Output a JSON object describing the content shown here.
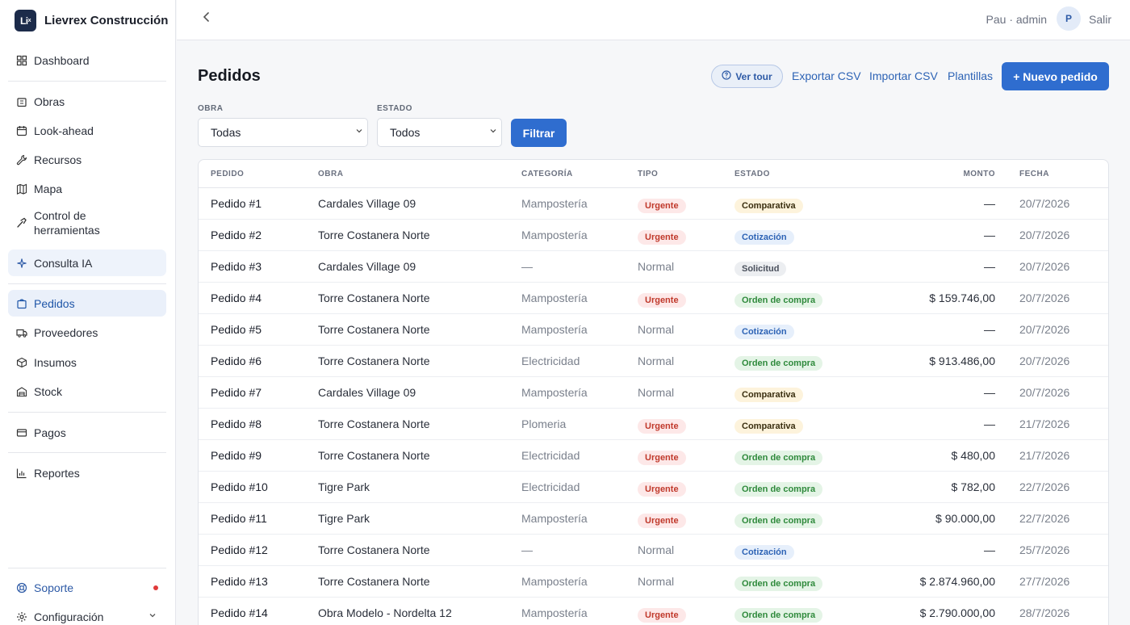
{
  "app": {
    "name": "Lievrex Construcción",
    "logo_text": "Li",
    "logo_sub": "x"
  },
  "sidebar": {
    "items": [
      {
        "label": "Dashboard",
        "icon": "grid-icon"
      },
      {
        "label": "Obras",
        "icon": "building-icon"
      },
      {
        "label": "Look-ahead",
        "icon": "calendar-icon"
      },
      {
        "label": "Recursos",
        "icon": "wrench-icon"
      },
      {
        "label": "Mapa",
        "icon": "map-icon"
      },
      {
        "label": "Control de herramientas",
        "icon": "hammer-icon"
      },
      {
        "label": "Consulta IA",
        "icon": "sparkle-icon"
      },
      {
        "label": "Pedidos",
        "icon": "cart-icon"
      },
      {
        "label": "Proveedores",
        "icon": "truck-icon"
      },
      {
        "label": "Insumos",
        "icon": "box-icon"
      },
      {
        "label": "Stock",
        "icon": "warehouse-icon"
      },
      {
        "label": "Pagos",
        "icon": "card-icon"
      },
      {
        "label": "Reportes",
        "icon": "bar-chart-icon"
      }
    ],
    "support_label": "Soporte",
    "settings_label": "Configuración",
    "active": "Pedidos"
  },
  "topbar": {
    "user": "Pau · admin",
    "avatar": "P",
    "logout": "Salir"
  },
  "page": {
    "title": "Pedidos",
    "tour_label": "Ver tour",
    "export_label": "Exportar CSV",
    "import_label": "Importar CSV",
    "templates_label": "Plantillas",
    "new_label": "+ Nuevo pedido"
  },
  "filters": {
    "obra_label": "OBRA",
    "obra_value": "Todas",
    "estado_label": "ESTADO",
    "estado_value": "Todos",
    "filter_label": "Filtrar"
  },
  "table": {
    "headers": {
      "pedido": "PEDIDO",
      "obra": "OBRA",
      "categoria": "CATEGORÍA",
      "tipo": "TIPO",
      "estado": "ESTADO",
      "monto": "MONTO",
      "fecha": "FECHA"
    },
    "rows": [
      {
        "pedido": "Pedido #1",
        "obra": "Cardales Village 09",
        "categoria": "Mampostería",
        "tipo": "Urgente",
        "estado": "Comparativa",
        "monto": "—",
        "fecha": "20/7/2026"
      },
      {
        "pedido": "Pedido #2",
        "obra": "Torre Costanera Norte",
        "categoria": "Mampostería",
        "tipo": "Urgente",
        "estado": "Cotización",
        "monto": "—",
        "fecha": "20/7/2026"
      },
      {
        "pedido": "Pedido #3",
        "obra": "Cardales Village 09",
        "categoria": "—",
        "tipo": "Normal",
        "estado": "Solicitud",
        "monto": "—",
        "fecha": "20/7/2026"
      },
      {
        "pedido": "Pedido #4",
        "obra": "Torre Costanera Norte",
        "categoria": "Mampostería",
        "tipo": "Urgente",
        "estado": "Orden de compra",
        "monto": "$ 159.746,00",
        "fecha": "20/7/2026"
      },
      {
        "pedido": "Pedido #5",
        "obra": "Torre Costanera Norte",
        "categoria": "Mampostería",
        "tipo": "Normal",
        "estado": "Cotización",
        "monto": "—",
        "fecha": "20/7/2026"
      },
      {
        "pedido": "Pedido #6",
        "obra": "Torre Costanera Norte",
        "categoria": "Electricidad",
        "tipo": "Normal",
        "estado": "Orden de compra",
        "monto": "$ 913.486,00",
        "fecha": "20/7/2026"
      },
      {
        "pedido": "Pedido #7",
        "obra": "Cardales Village 09",
        "categoria": "Mampostería",
        "tipo": "Normal",
        "estado": "Comparativa",
        "monto": "—",
        "fecha": "20/7/2026"
      },
      {
        "pedido": "Pedido #8",
        "obra": "Torre Costanera Norte",
        "categoria": "Plomeria",
        "tipo": "Urgente",
        "estado": "Comparativa",
        "monto": "—",
        "fecha": "21/7/2026"
      },
      {
        "pedido": "Pedido #9",
        "obra": "Torre Costanera Norte",
        "categoria": "Electricidad",
        "tipo": "Urgente",
        "estado": "Orden de compra",
        "monto": "$ 480,00",
        "fecha": "21/7/2026"
      },
      {
        "pedido": "Pedido #10",
        "obra": "Tigre Park",
        "categoria": "Electricidad",
        "tipo": "Urgente",
        "estado": "Orden de compra",
        "monto": "$ 782,00",
        "fecha": "22/7/2026"
      },
      {
        "pedido": "Pedido #11",
        "obra": "Tigre Park",
        "categoria": "Mampostería",
        "tipo": "Urgente",
        "estado": "Orden de compra",
        "monto": "$ 90.000,00",
        "fecha": "22/7/2026"
      },
      {
        "pedido": "Pedido #12",
        "obra": "Torre Costanera Norte",
        "categoria": "—",
        "tipo": "Normal",
        "estado": "Cotización",
        "monto": "—",
        "fecha": "25/7/2026"
      },
      {
        "pedido": "Pedido #13",
        "obra": "Torre Costanera Norte",
        "categoria": "Mampostería",
        "tipo": "Normal",
        "estado": "Orden de compra",
        "monto": "$ 2.874.960,00",
        "fecha": "27/7/2026"
      },
      {
        "pedido": "Pedido #14",
        "obra": "Obra Modelo - Nordelta 12",
        "categoria": "Mampostería",
        "tipo": "Urgente",
        "estado": "Orden de compra",
        "monto": "$ 2.790.000,00",
        "fecha": "28/7/2026"
      }
    ]
  },
  "colors": {
    "accent": "#2f6dcf",
    "urgente_bg": "#fde8e8",
    "urgente_fg": "#c0392b",
    "comparativa_bg": "#fdf3dc",
    "comparativa_fg": "#3a2f10",
    "cotizacion_bg": "#e6effb",
    "cotizacion_fg": "#2d63b5",
    "solicitud_bg": "#eceef1",
    "solicitud_fg": "#4a505c",
    "orden_bg": "#e4f4e6",
    "orden_fg": "#2f8a3c"
  }
}
